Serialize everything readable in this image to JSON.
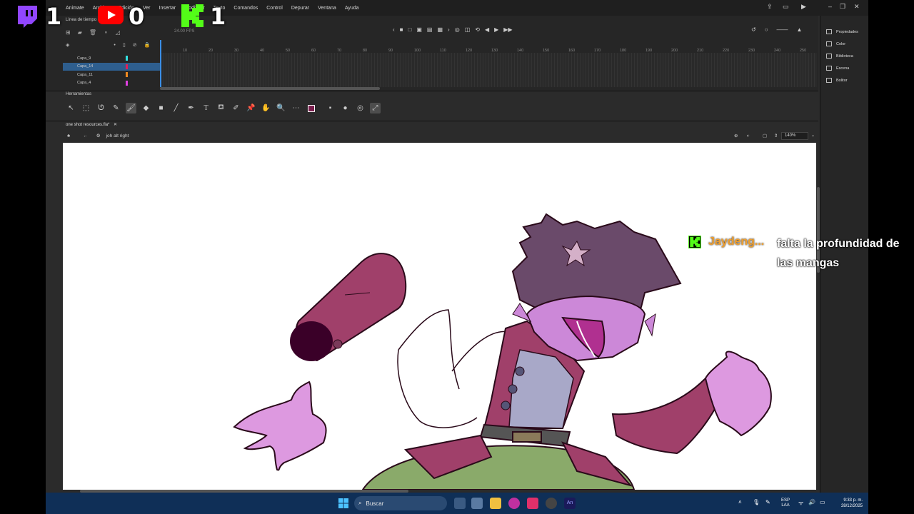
{
  "menubar": {
    "items": [
      "Animate",
      "Archivo",
      "Edición",
      "Ver",
      "Insertar",
      "Modificar",
      "Texto",
      "Comandos",
      "Control",
      "Depurar",
      "Ventana",
      "Ayuda"
    ]
  },
  "timeline": {
    "title": "Línea de tiempo",
    "fps": "24.00",
    "fps_unit": "FPS",
    "frame_ruler": [
      "10",
      "20",
      "30",
      "40",
      "50",
      "60",
      "70",
      "80",
      "90",
      "100",
      "110",
      "120",
      "130",
      "140",
      "150",
      "160",
      "170",
      "180",
      "190",
      "200",
      "210",
      "220",
      "230",
      "240",
      "250"
    ],
    "layers": [
      {
        "name": "Capa_9",
        "color": "#33e0e0",
        "selected": false
      },
      {
        "name": "Capa_14",
        "color": "#e0205a",
        "selected": true
      },
      {
        "name": "Capa_11",
        "color": "#f08a20",
        "selected": false
      },
      {
        "name": "Capa_4",
        "color": "#e040e0",
        "selected": false
      }
    ]
  },
  "tools": {
    "title": "Herramientas",
    "fill_color": "#ffffff",
    "stroke_color": "#7b1f4e"
  },
  "document": {
    "tab": "one shot resources.fla*",
    "symbol": "joh alt right",
    "zoom": "140%"
  },
  "right_panel": {
    "items": [
      "Propiedades",
      "Color",
      "Biblioteca",
      "Escena",
      "Bolitor"
    ]
  },
  "overlay": {
    "twitch_count": "1",
    "youtube_count": "0",
    "kick_count": "1",
    "chat_user": "Jaydeng...",
    "chat_message": "falta la profundidad de las mangas",
    "kick_color": "#53fc18",
    "twitch_color": "#9146ff"
  },
  "taskbar": {
    "search_placeholder": "Buscar",
    "lang_top": "ESP",
    "lang_bottom": "LAA",
    "time": "9:33 p. m.",
    "date": "28/12/2025"
  },
  "colors": {
    "accent": "#2e5e8e",
    "stage_bg": "#ffffff",
    "taskbar_bg": "#0f2f57"
  }
}
